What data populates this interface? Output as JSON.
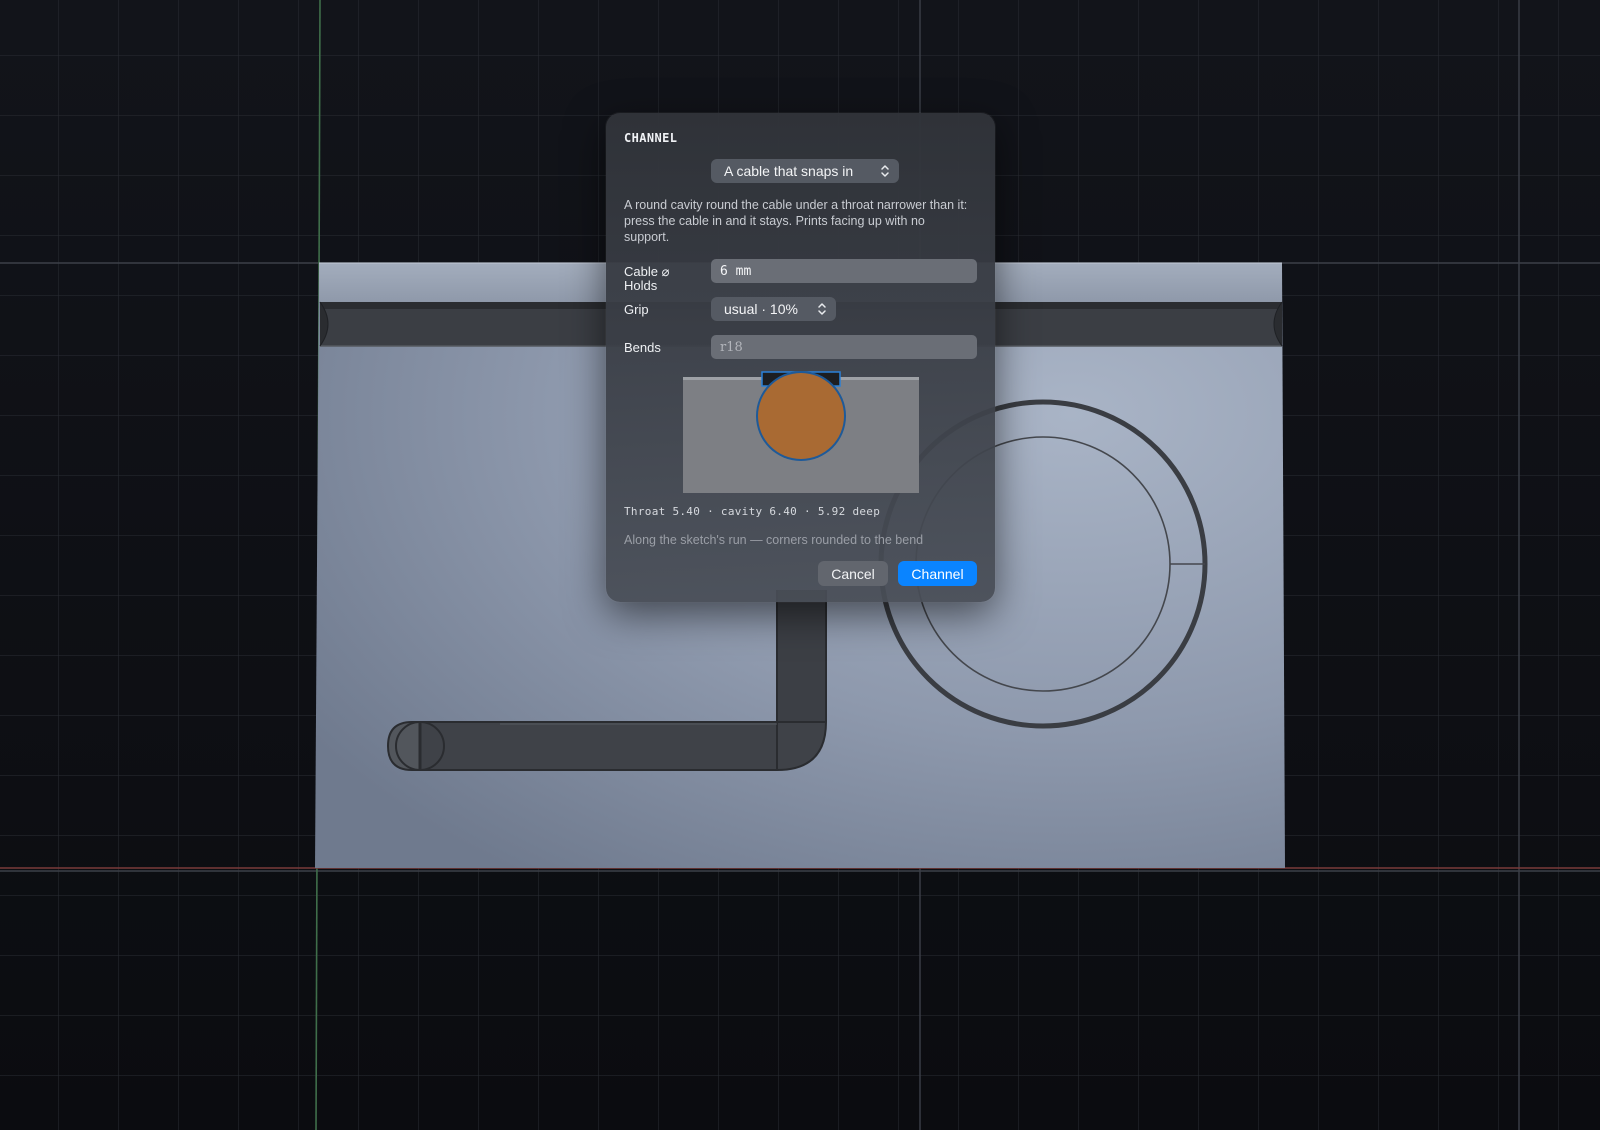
{
  "dialog": {
    "title": "CHANNEL",
    "holds": {
      "label": "Holds",
      "value": "A cable that snaps in"
    },
    "description": "A round cavity round the cable under a throat narrower than it: press the cable in and it stays. Prints facing up with no support.",
    "cable": {
      "label": "Cable ⌀",
      "value": "6 mm"
    },
    "grip": {
      "label": "Grip",
      "value": "usual · 10%"
    },
    "bends": {
      "label": "Bends",
      "placeholder": "r18"
    },
    "stats": "Throat 5.40 · cavity 6.40 · 5.92 deep",
    "hint": "Along the sketch's run — corners rounded to the bend",
    "buttons": {
      "cancel": "Cancel",
      "confirm": "Channel"
    }
  },
  "colors": {
    "accent": "#0a84ff",
    "cable": "#a96a33",
    "part_face": "#93a0b6",
    "background": "#0f1116"
  },
  "icons": {
    "select_chevron": "chevron-up-down-icon"
  }
}
